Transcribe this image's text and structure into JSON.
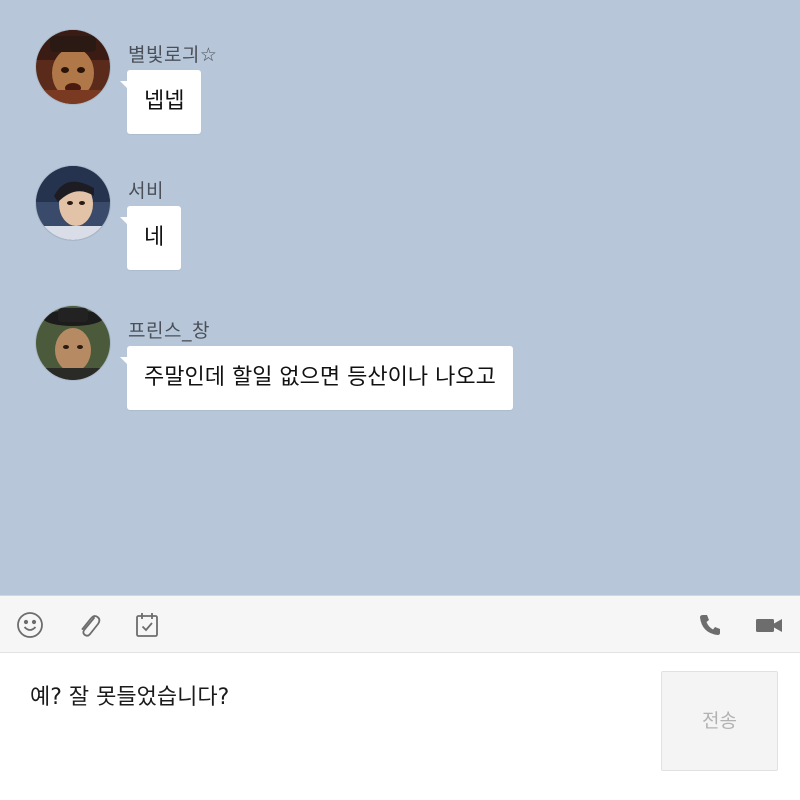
{
  "messages": [
    {
      "sender": "별빛로긔☆",
      "text": "넵넵"
    },
    {
      "sender": "서비",
      "text": "네"
    },
    {
      "sender": "프린스_창",
      "text": "주말인데 할일 없으면 등산이나 나오고"
    }
  ],
  "toolbar": {
    "left_icons": [
      "emoji-icon",
      "attachment-icon",
      "calendar-icon"
    ],
    "right_icons": [
      "phone-icon",
      "video-call-icon"
    ]
  },
  "composer": {
    "input_value": "예? 잘 못들었습니다?",
    "send_label": "전송"
  },
  "colors": {
    "chat_background": "#b7c7d9",
    "bubble": "#ffffff",
    "toolbar_background": "#f6f6f6",
    "icon": "#6d6d6d"
  }
}
